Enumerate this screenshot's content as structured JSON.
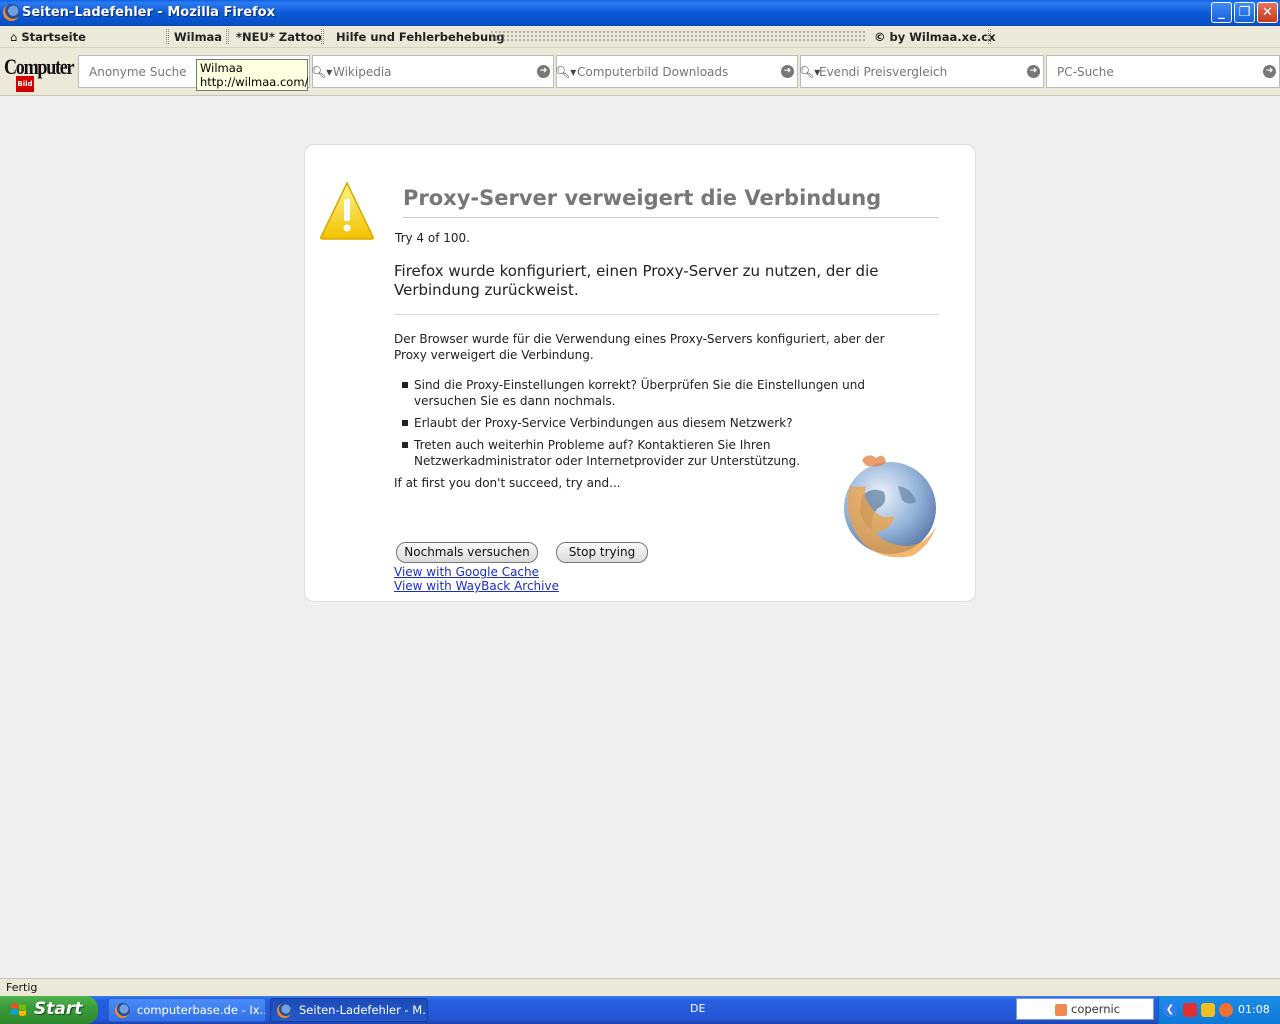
{
  "window": {
    "title": "Seiten-Ladefehler - Mozilla Firefox"
  },
  "bookmarks": {
    "items": [
      "Startseite",
      "Wilmaa",
      "*NEU* Zattoo",
      "Hilfe und Fehlerbehebung",
      "© by Wilmaa.xe.cx"
    ]
  },
  "cbtoolbar": {
    "logo": "Computer",
    "logo_sub": "Bild",
    "fields": [
      "Anonyme Suche",
      "Wikipedia",
      "Computerbild Downloads",
      "Evendi Preisvergleich",
      "PC-Suche"
    ],
    "tooltip": {
      "line1": "Wilmaa",
      "line2": "http://wilmaa.com/"
    }
  },
  "error": {
    "title": "Proxy-Server verweigert die Verbindung",
    "tries": "Try 4 of 100.",
    "short_desc": "Firefox wurde konfiguriert, einen Proxy-Server zu nutzen, der die Verbindung zurückweist.",
    "long_desc": "Der Browser wurde für die Verwendung eines Proxy-Servers konfiguriert, aber der Proxy verweigert die Verbindung.",
    "reasons": [
      "Sind die Proxy-Einstellungen korrekt? Überprüfen Sie die Einstellungen und versuchen Sie es dann nochmals.",
      "Erlaubt der Proxy-Service Verbindungen aus diesem Netzwerk?",
      "Treten auch weiterhin Probleme auf? Kontaktieren Sie Ihren Netzwerkadministrator oder Internetprovider zur Unterstützung."
    ],
    "if_first": "If at first you don't succeed, try and...",
    "retry_button": "Nochmals versuchen",
    "stop_button": "Stop trying",
    "link_cache": "View with Google Cache",
    "link_wayback": "View with WayBack Archive"
  },
  "status": {
    "text": "Fertig"
  },
  "taskbar": {
    "start": "Start",
    "tasks": [
      "computerbase.de - Ix...",
      "Seiten-Ladefehler - M..."
    ],
    "language": "DE",
    "search_box": "copernic",
    "clock": "01:08"
  },
  "colors": {
    "title_bar": "#0a5fe0",
    "heading": "#777777",
    "link": "#1a2ec8",
    "taskbar": "#2457d6"
  }
}
